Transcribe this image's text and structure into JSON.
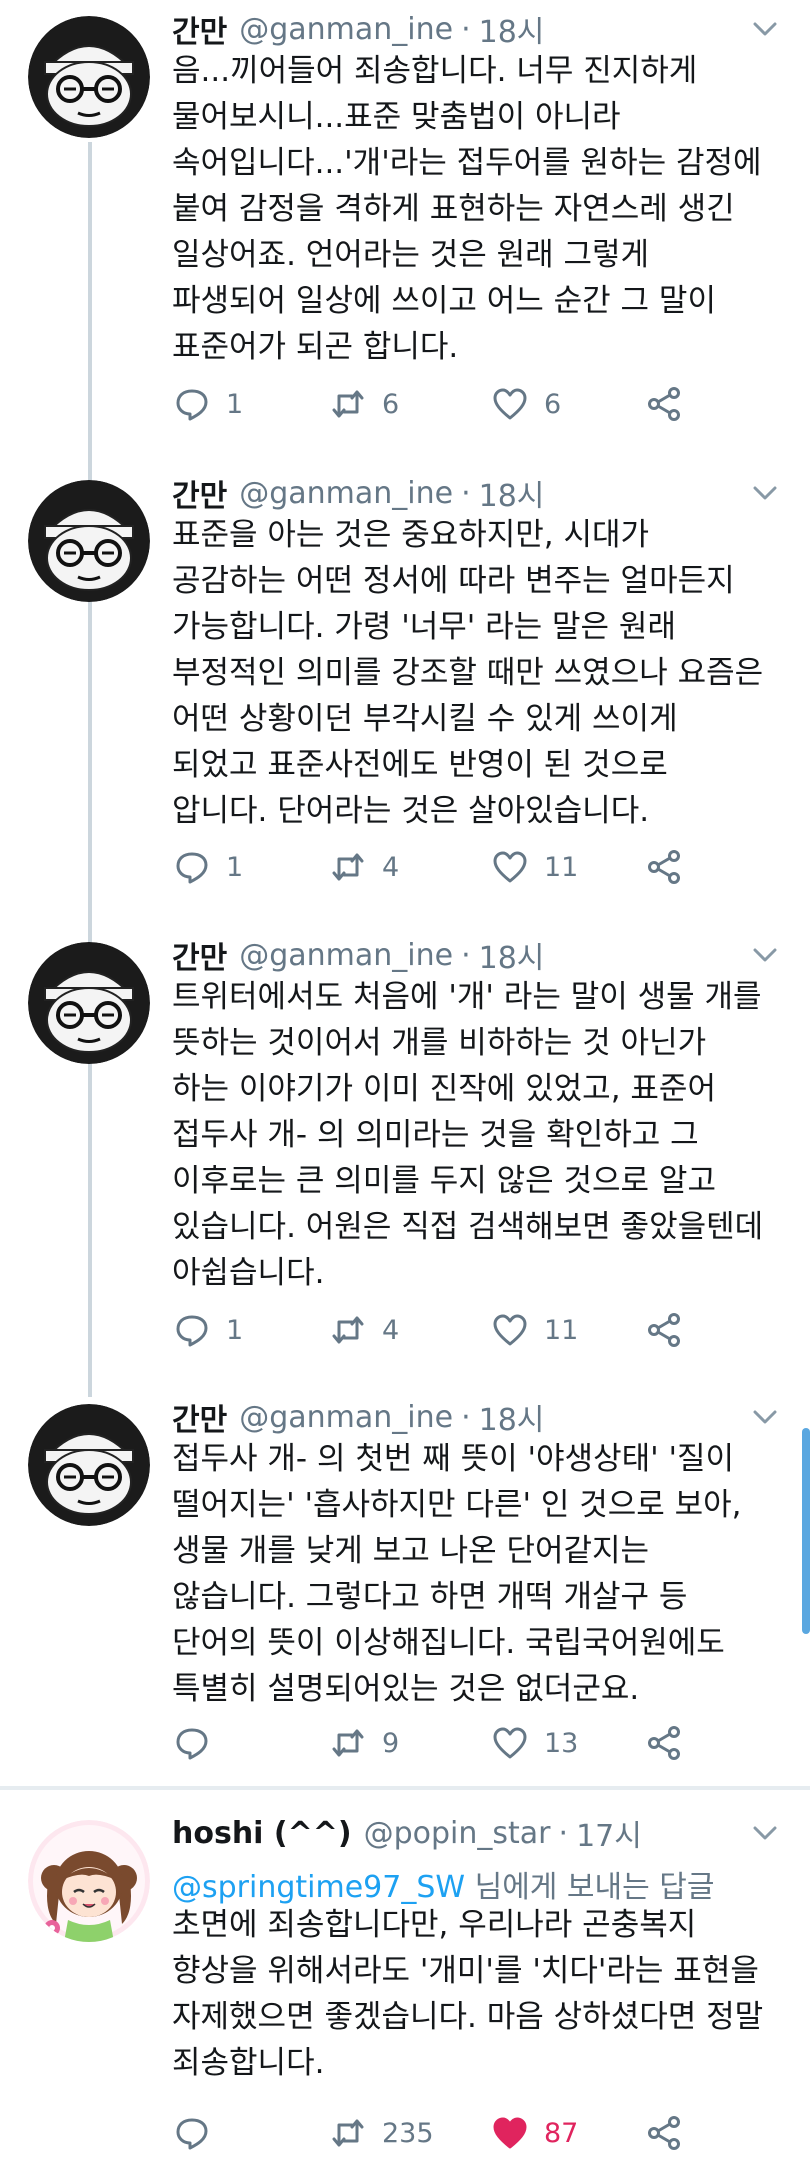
{
  "tweets": [
    {
      "name": "간만",
      "handle": "@ganman_ine",
      "time": "18시",
      "lines": [
        "음...끼어들어 죄송합니다. 너무 진지하게",
        "물어보시니...표준 맞춤법이 아니라",
        "속어입니다...'개'라는 접두어를 원하는 감정에",
        "붙여 감정을 격하게 표현하는 자연스레 생긴",
        "일상어죠. 언어라는 것은 원래 그렇게",
        "파생되어 일상에 쓰이고 어느 순간 그 말이",
        "표준어가 되곤 합니다."
      ],
      "replies": "1",
      "retweets": "6",
      "likes": "6"
    },
    {
      "name": "간만",
      "handle": "@ganman_ine",
      "time": "18시",
      "lines": [
        "표준을 아는 것은 중요하지만, 시대가",
        "공감하는 어떤 정서에 따라 변주는 얼마든지",
        "가능합니다. 가령 '너무' 라는 말은 원래",
        "부정적인 의미를 강조할 때만 쓰였으나 요즘은",
        "어떤 상황이던 부각시킬 수 있게 쓰이게",
        "되었고 표준사전에도 반영이 된 것으로",
        "압니다. 단어라는 것은 살아있습니다."
      ],
      "replies": "1",
      "retweets": "4",
      "likes": "11"
    },
    {
      "name": "간만",
      "handle": "@ganman_ine",
      "time": "18시",
      "lines": [
        "트위터에서도 처음에 '개' 라는 말이 생물 개를",
        "뜻하는 것이어서 개를 비하하는 것 아닌가",
        "하는 이야기가 이미 진작에 있었고, 표준어",
        "접두사 개- 의 의미라는 것을 확인하고 그",
        "이후로는 큰 의미를 두지 않은 것으로 알고",
        "있습니다. 어원은 직접 검색해보면 좋았을텐데",
        "아쉽습니다."
      ],
      "replies": "1",
      "retweets": "4",
      "likes": "11"
    },
    {
      "name": "간만",
      "handle": "@ganman_ine",
      "time": "18시",
      "lines": [
        "접두사 개- 의 첫번 째 뜻이 '야생상태' '질이",
        "떨어지는' '흡사하지만 다른' 인 것으로 보아,",
        "생물 개를 낮게 보고 나온 단어같지는",
        "않습니다. 그렇다고 하면 개떡 개살구 등",
        "단어의 뜻이 이상해집니다. 국립국어원에도",
        "특별히 설명되어있는 것은 없더군요."
      ],
      "replies": "",
      "retweets": "9",
      "likes": "13"
    },
    {
      "name": "hoshi (^^)",
      "handle": "@popin_star",
      "time": "17시",
      "reply_mention": "@springtime97_SW",
      "reply_rest": " 님에게 보내는 답글",
      "lines": [
        "초면에 죄송합니다만, 우리나라 곤충복지",
        "향상을 위해서라도 '개미'를 '치다'라는 표현을",
        "자제했으면 좋겠습니다. 마음 상하셨다면 정말",
        "죄송합니다."
      ],
      "replies": "",
      "retweets": "235",
      "likes": "87"
    }
  ],
  "icons": {
    "reply": "reply-icon",
    "retweet": "retweet-icon",
    "like": "heart-icon",
    "share": "share-icon",
    "more": "chevron-down-icon"
  },
  "colors": {
    "text": "#14171a",
    "secondary": "#657786",
    "link": "#1da1f2",
    "like_active": "#e0245e",
    "thread_line": "#ccd6dd",
    "divider": "#e6ecf0"
  }
}
